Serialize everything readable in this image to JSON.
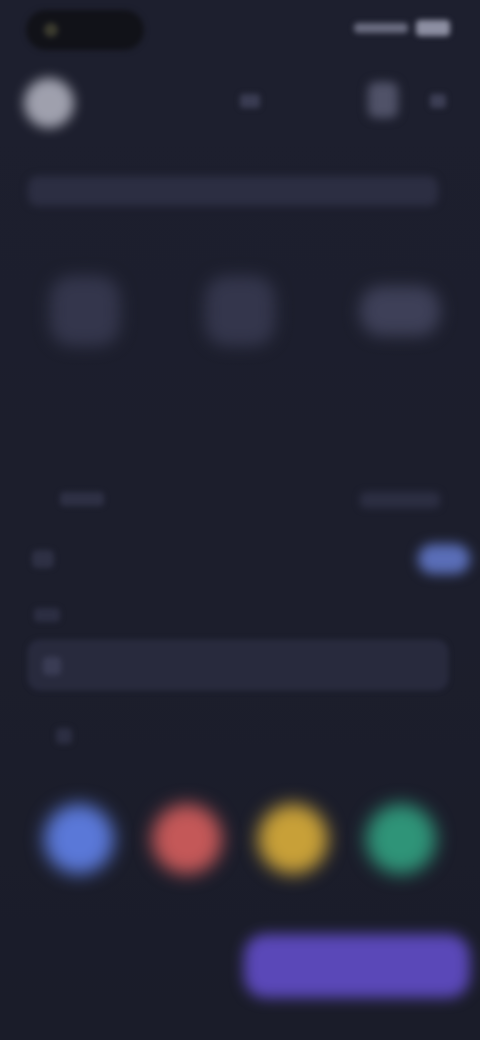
{
  "status_bar": {
    "time": "",
    "signal_icon": "signal-icon",
    "battery_icon": "battery-icon"
  },
  "header": {
    "avatar_icon": "avatar",
    "center_icon": "chevron-icon",
    "right_icon": "profile-icon",
    "menu_icon": "menu-icon"
  },
  "title": {
    "text": ""
  },
  "stats": [
    {
      "icon": "stat-icon",
      "value": "",
      "label": ""
    },
    {
      "icon": "stat-icon",
      "value": "",
      "label": ""
    },
    {
      "icon": "stat-icon",
      "value": "",
      "label": ""
    }
  ],
  "panel": {
    "center_title": "",
    "center_subtitle": "",
    "toggle_on": true
  },
  "field": {
    "value": "",
    "icon": "search-icon"
  },
  "hint": {
    "text": ""
  },
  "colors": {
    "options": [
      {
        "label": "",
        "color": "#5a78d8"
      },
      {
        "label": "",
        "color": "#c45858"
      },
      {
        "label": "",
        "color": "#c8a038"
      },
      {
        "label": "",
        "color": "#2f9478"
      }
    ]
  },
  "actions": {
    "cancel_label": "",
    "primary_label": "",
    "primary_color": "#5a48b8"
  }
}
